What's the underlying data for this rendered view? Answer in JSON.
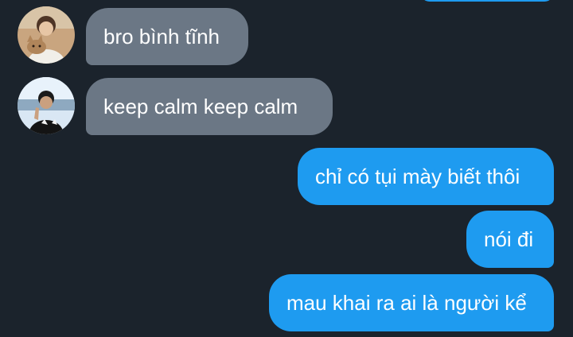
{
  "messages": [
    {
      "direction": "incoming",
      "text": "bro bình tĩnh",
      "avatar": "user-avatar-with-dog"
    },
    {
      "direction": "incoming",
      "text": "keep calm keep calm",
      "avatar": "user-avatar-outdoor"
    },
    {
      "direction": "outgoing",
      "text": "chỉ có tụi mày biết thôi"
    },
    {
      "direction": "outgoing",
      "text": "nói đi"
    },
    {
      "direction": "outgoing",
      "text": "mau khai ra ai là người kể"
    }
  ],
  "colors": {
    "background": "#1b232c",
    "incoming_bubble": "#6b7785",
    "outgoing_bubble": "#1e9bf0",
    "text": "#ffffff"
  }
}
